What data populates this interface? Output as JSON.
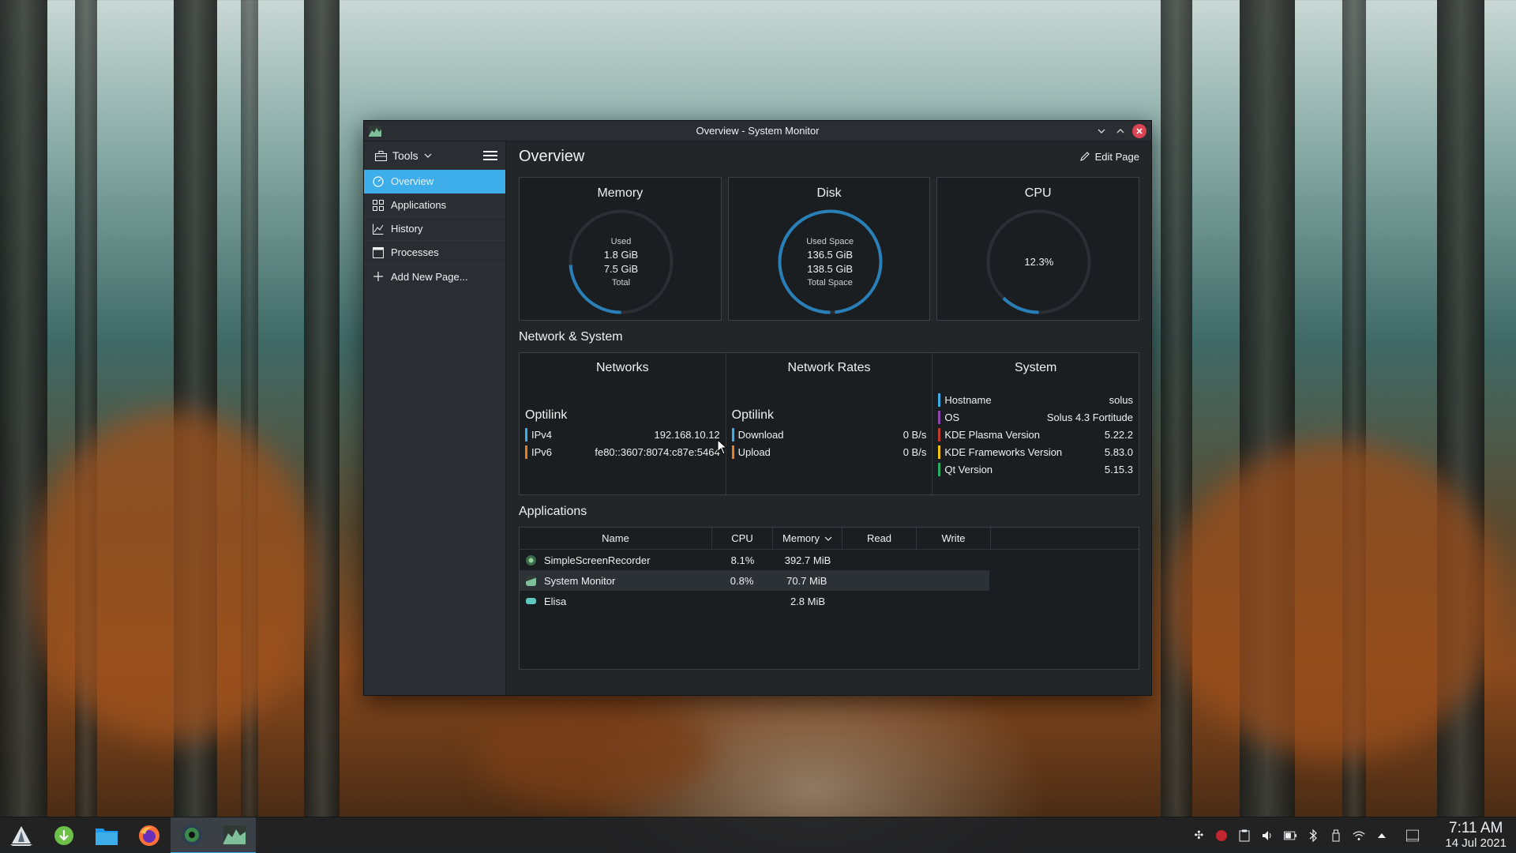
{
  "window": {
    "title": "Overview - System Monitor"
  },
  "sidebar": {
    "tools_label": "Tools",
    "items": [
      {
        "label": "Overview",
        "icon": "overview-icon",
        "active": true
      },
      {
        "label": "Applications",
        "icon": "grid-icon"
      },
      {
        "label": "History",
        "icon": "chart-icon"
      },
      {
        "label": "Processes",
        "icon": "window-icon"
      },
      {
        "label": "Add New Page...",
        "icon": "plus-icon"
      }
    ]
  },
  "main": {
    "title": "Overview",
    "edit_label": "Edit Page"
  },
  "cards": {
    "memory": {
      "title": "Memory",
      "top_label": "Used",
      "used": "1.8 GiB",
      "total": "7.5 GiB",
      "bottom_label": "Total",
      "fraction": 0.24
    },
    "disk": {
      "title": "Disk",
      "top_label": "Used Space",
      "used": "136.5 GiB",
      "total": "138.5 GiB",
      "bottom_label": "Total Space",
      "fraction": 0.985
    },
    "cpu": {
      "title": "CPU",
      "value": "12.3%",
      "fraction": 0.123
    }
  },
  "network_system": {
    "section_title": "Network & System",
    "networks": {
      "title": "Networks",
      "interface": "Optilink",
      "ipv4_label": "IPv4",
      "ipv4": "192.168.10.12",
      "ipv6_label": "IPv6",
      "ipv6": "fe80::3607:8074:c87e:5464"
    },
    "rates": {
      "title": "Network Rates",
      "interface": "Optilink",
      "download_label": "Download",
      "download": "0 B/s",
      "upload_label": "Upload",
      "upload": "0 B/s"
    },
    "system": {
      "title": "System",
      "rows": [
        {
          "label": "Hostname",
          "value": "solus",
          "color": "#3daee9"
        },
        {
          "label": "OS",
          "value": "Solus 4.3 Fortitude",
          "color": "#8e44ad"
        },
        {
          "label": "KDE Plasma Version",
          "value": "5.22.2",
          "color": "#c0392b"
        },
        {
          "label": "KDE Frameworks Version",
          "value": "5.83.0",
          "color": "#f1c40f"
        },
        {
          "label": "Qt Version",
          "value": "5.15.3",
          "color": "#27ae60"
        }
      ]
    }
  },
  "applications": {
    "section_title": "Applications",
    "headers": {
      "name": "Name",
      "cpu": "CPU",
      "memory": "Memory",
      "read": "Read",
      "write": "Write"
    },
    "rows": [
      {
        "name": "SimpleScreenRecorder",
        "cpu": "8.1%",
        "memory": "392.7 MiB",
        "read": "",
        "write": "",
        "icon_color": "#4a8a5a"
      },
      {
        "name": "System Monitor",
        "cpu": "0.8%",
        "memory": "70.7 MiB",
        "read": "",
        "write": "",
        "icon_color": "#7fbf9a"
      },
      {
        "name": "Elisa",
        "cpu": "",
        "memory": "2.8 MiB",
        "read": "",
        "write": "",
        "icon_color": "#5fc9c0"
      }
    ]
  },
  "clock": {
    "time": "7:11 AM",
    "date": "14 Jul 2021"
  },
  "colors": {
    "accent": "#3daee9",
    "ipv4_bar": "#3daee9",
    "ipv6_bar": "#e67e22",
    "download_bar": "#3daee9",
    "upload_bar": "#e67e22"
  }
}
